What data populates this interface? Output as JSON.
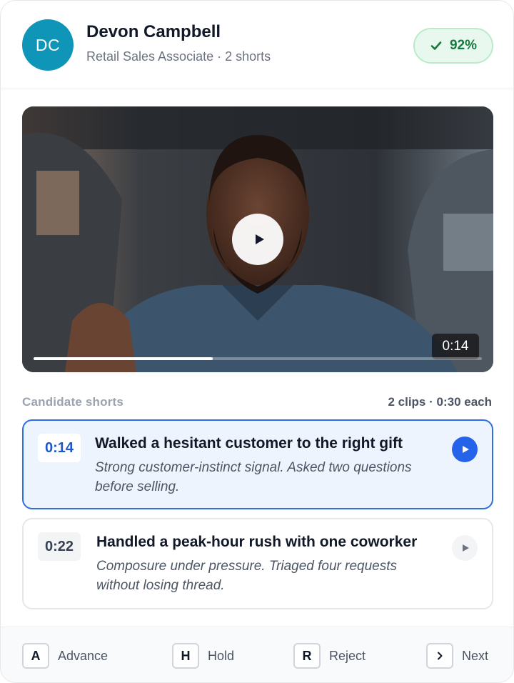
{
  "candidate": {
    "initials": "DC",
    "name": "Devon Campbell",
    "subtitle": "Retail Sales Associate · 2 shorts",
    "score": "92%"
  },
  "video": {
    "current_time": "0:14",
    "progress": 0.4
  },
  "shorts": {
    "label": "Candidate shorts",
    "meta": "2 clips · 0:30 each",
    "items": [
      {
        "time": "0:14",
        "title": "Walked a hesitant customer to the right gift",
        "description": "Strong customer-instinct signal. Asked two questions before selling."
      },
      {
        "time": "0:22",
        "title": "Handled a peak-hour rush with one coworker",
        "description": "Composure under pressure. Triaged four requests without losing thread."
      }
    ]
  },
  "actions": [
    {
      "key": "A",
      "label": "Advance"
    },
    {
      "key": "H",
      "label": "Hold"
    },
    {
      "key": "R",
      "label": "Reject"
    },
    {
      "key": "chevron-right-icon",
      "label": "Next"
    }
  ],
  "colors": {
    "accent": "#2563eb",
    "avatar": "#0e95b8",
    "score_text": "#137a3e",
    "score_bg": "#e8f8ee"
  }
}
